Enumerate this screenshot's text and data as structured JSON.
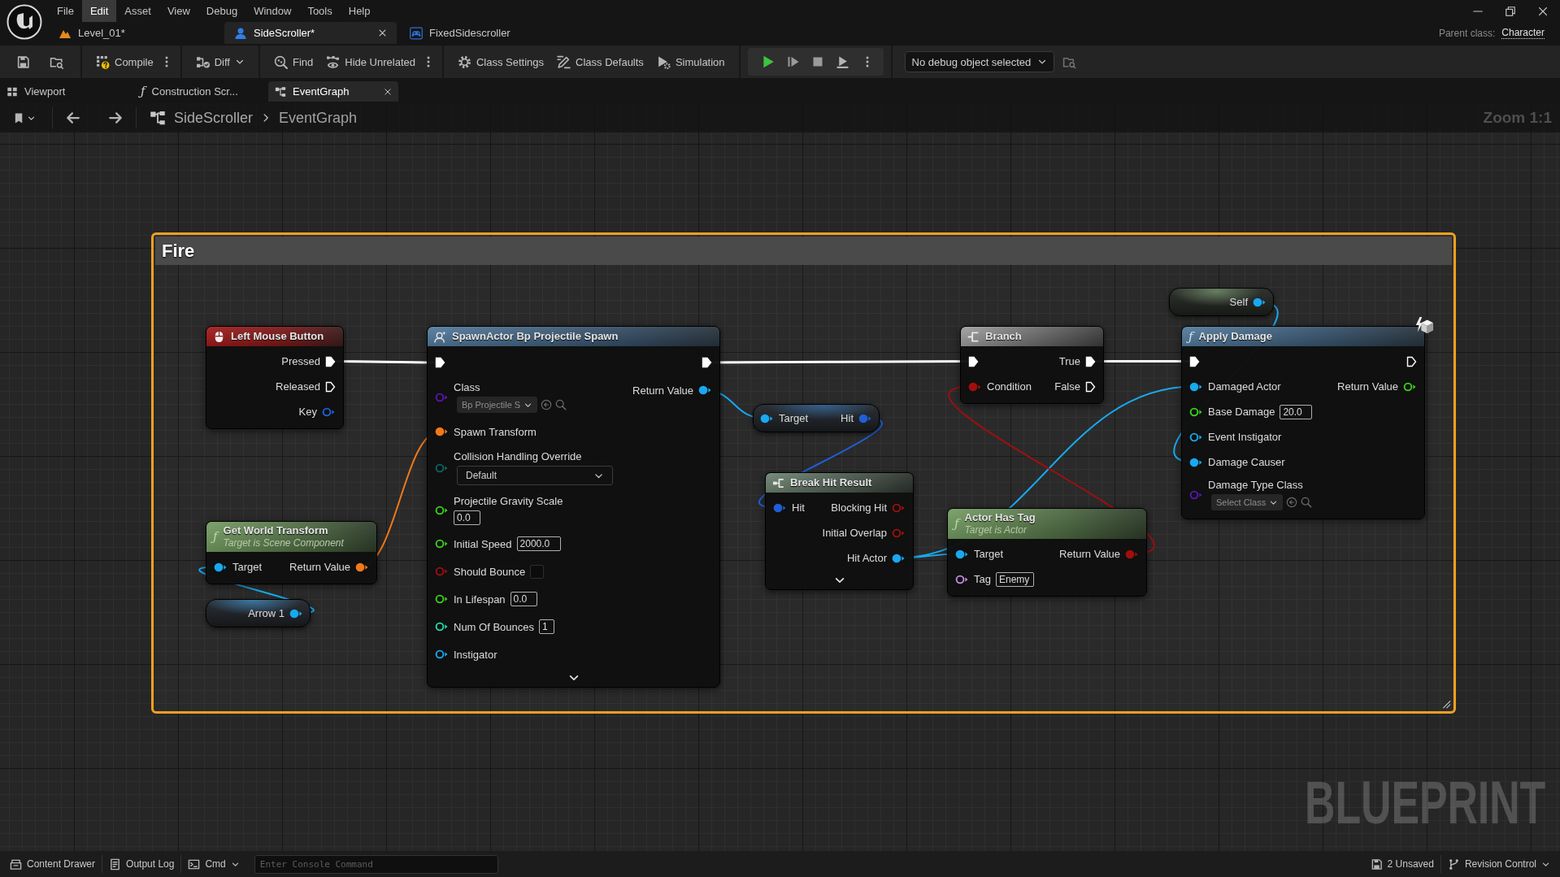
{
  "menu_bar": {
    "items": [
      {
        "label": "File",
        "selected": false
      },
      {
        "label": "Edit",
        "selected": true
      },
      {
        "label": "Asset",
        "selected": false
      },
      {
        "label": "View",
        "selected": false
      },
      {
        "label": "Debug",
        "selected": false
      },
      {
        "label": "Window",
        "selected": false
      },
      {
        "label": "Tools",
        "selected": false
      },
      {
        "label": "Help",
        "selected": false
      }
    ]
  },
  "document_tabs": [
    {
      "label": "Level_01*",
      "selected": false
    },
    {
      "label": "SideScroller*",
      "selected": true
    },
    {
      "label": "FixedSidescroller",
      "selected": false
    }
  ],
  "parent_class": {
    "label": "Parent class:",
    "value": "Character"
  },
  "toolbar": {
    "buttons": [
      "Compile",
      "Diff",
      "Find",
      "Hide Unrelated",
      "Class Settings",
      "Class Defaults",
      "Simulation"
    ],
    "debug_object": "No debug object selected"
  },
  "panel_tabs": [
    {
      "label": "Viewport",
      "selected": false
    },
    {
      "label": "Construction Scr...",
      "glyph": "ƒ",
      "selected": false
    },
    {
      "label": "EventGraph",
      "selected": true
    }
  ],
  "breadcrumb": {
    "items": [
      "SideScroller",
      "EventGraph"
    ],
    "zoom": "Zoom 1:1"
  },
  "graph": {
    "comment_title": "Fire",
    "nodes": [
      {
        "kind": "event",
        "title": "Left Mouse Button",
        "outputs": [
          {
            "label": "Pressed",
            "kind": "exec",
            "connected": true
          },
          {
            "label": "Released",
            "kind": "exec",
            "connected": false
          },
          {
            "label": "Key",
            "kind": "struct",
            "connected": false
          }
        ]
      },
      {
        "kind": "call",
        "title": "SpawnActor Bp Projectile Spawn",
        "inputs": [
          {
            "kind": "exec",
            "connected": true
          },
          {
            "label": "Class",
            "kind": "class",
            "connected": false,
            "asset": "Bp Projectile S"
          },
          {
            "label": "Spawn Transform",
            "kind": "transform",
            "connected": true
          },
          {
            "label": "Collision Handling Override",
            "kind": "enum",
            "connected": false,
            "option": "Default"
          },
          {
            "label": "Projectile Gravity Scale",
            "kind": "float",
            "connected": false,
            "value": "0.0"
          },
          {
            "label": "Initial Speed",
            "kind": "float",
            "connected": false,
            "value": "2000.0"
          },
          {
            "label": "Should Bounce",
            "kind": "bool",
            "connected": false,
            "checked": false
          },
          {
            "label": "In Lifespan",
            "kind": "float",
            "connected": false,
            "value": "0.0"
          },
          {
            "label": "Num Of Bounces",
            "kind": "int",
            "connected": false,
            "value": "1"
          },
          {
            "label": "Instigator",
            "kind": "object",
            "connected": false
          }
        ],
        "outputs": [
          {
            "kind": "exec",
            "connected": true
          },
          {
            "label": "Return Value",
            "kind": "object",
            "connected": true
          }
        ],
        "expanded": false
      },
      {
        "kind": "pure",
        "glyph": "ƒ",
        "title": "Get World Transform",
        "subtitle": "Target is Scene Component",
        "inputs": [
          {
            "label": "Target",
            "kind": "object",
            "connected": true
          }
        ],
        "outputs": [
          {
            "label": "Return Value",
            "kind": "transform",
            "connected": true
          }
        ]
      },
      {
        "kind": "variable",
        "outputs": [
          {
            "label": "Arrow 1",
            "kind": "object",
            "connected": true
          }
        ]
      },
      {
        "kind": "compact",
        "inputs": [
          {
            "label": "Target",
            "kind": "object",
            "connected": true
          }
        ],
        "outputs": [
          {
            "label": "Hit",
            "kind": "struct",
            "connected": true
          }
        ]
      },
      {
        "kind": "break",
        "title": "Break Hit Result",
        "inputs": [
          {
            "label": "Hit",
            "kind": "struct",
            "connected": true
          }
        ],
        "outputs": [
          {
            "label": "Blocking Hit",
            "kind": "bool",
            "connected": false
          },
          {
            "label": "Initial Overlap",
            "kind": "bool",
            "connected": false
          },
          {
            "label": "Hit Actor",
            "kind": "object",
            "connected": true
          }
        ],
        "expanded": false
      },
      {
        "kind": "branch",
        "title": "Branch",
        "inputs": [
          {
            "kind": "exec",
            "connected": true
          },
          {
            "label": "Condition",
            "kind": "bool",
            "connected": true
          }
        ],
        "outputs": [
          {
            "label": "True",
            "kind": "exec",
            "connected": true
          },
          {
            "label": "False",
            "kind": "exec",
            "connected": false
          }
        ]
      },
      {
        "kind": "pure",
        "glyph": "ƒ",
        "title": "Actor Has Tag",
        "subtitle": "Target is Actor",
        "inputs": [
          {
            "label": "Target",
            "kind": "object",
            "connected": true
          },
          {
            "label": "Tag",
            "kind": "name",
            "connected": false,
            "value": "Enemy"
          }
        ],
        "outputs": [
          {
            "label": "Return Value",
            "kind": "bool",
            "connected": true
          }
        ]
      },
      {
        "kind": "self",
        "outputs": [
          {
            "label": "Self",
            "kind": "object",
            "connected": true
          }
        ]
      },
      {
        "kind": "call",
        "glyph": "ƒ",
        "title": "Apply Damage",
        "inputs": [
          {
            "kind": "exec",
            "connected": true
          },
          {
            "label": "Damaged Actor",
            "kind": "object",
            "connected": true
          },
          {
            "label": "Base Damage",
            "kind": "float",
            "connected": false,
            "value": "20.0"
          },
          {
            "label": "Event Instigator",
            "kind": "object",
            "connected": false
          },
          {
            "label": "Damage Causer",
            "kind": "object",
            "connected": true
          },
          {
            "label": "Damage Type Class",
            "kind": "class",
            "connected": false,
            "asset": "Select Class"
          }
        ],
        "outputs": [
          {
            "kind": "exec",
            "connected": false
          },
          {
            "label": "Return Value",
            "kind": "float",
            "connected": false
          }
        ]
      }
    ],
    "graph_label": "BLUEPRINT"
  },
  "status_bar": {
    "buttons": [
      "Content Drawer",
      "Output Log",
      "Cmd"
    ],
    "console_placeholder": "Enter Console Command",
    "unsaved": "2 Unsaved",
    "revision_control": "Revision Control"
  }
}
